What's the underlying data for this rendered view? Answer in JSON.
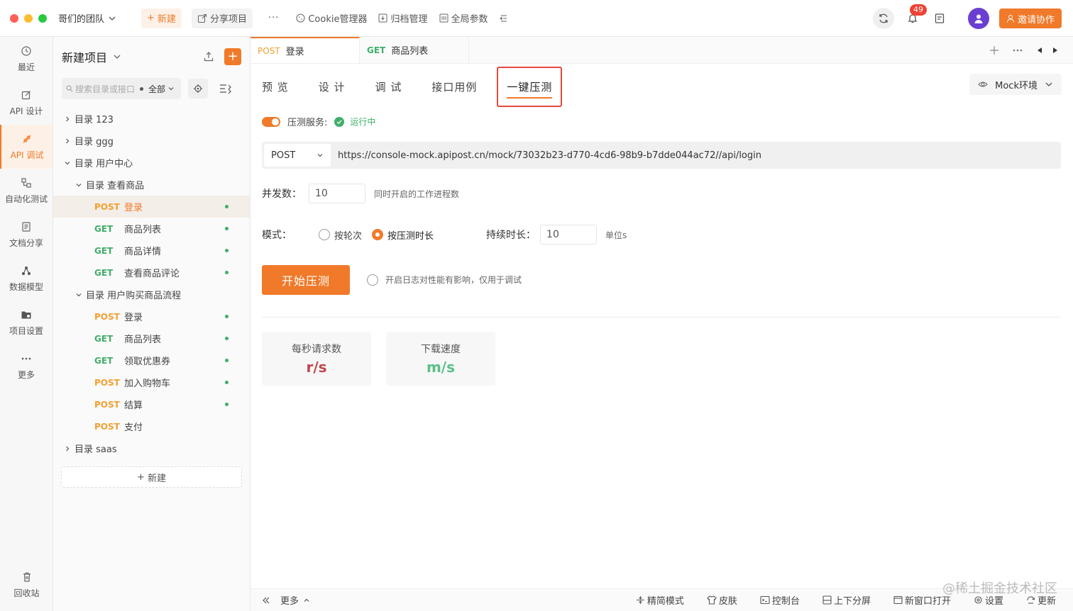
{
  "titlebar": {
    "team": "哥们的团队",
    "new_label": "新建",
    "share_label": "分享项目",
    "more": "···",
    "cookie_label": "Cookie管理器",
    "archive_label": "归档管理",
    "global_label": "全局参数",
    "notifications": "49",
    "invite_label": "邀请协作"
  },
  "rail": {
    "items": [
      {
        "label": "最近",
        "icon": "clock-icon"
      },
      {
        "label": "API 设计",
        "icon": "edit-icon"
      },
      {
        "label": "API 调试",
        "icon": "debug-icon"
      },
      {
        "label": "自动化测试",
        "icon": "flow-icon"
      },
      {
        "label": "文档分享",
        "icon": "doc-icon"
      },
      {
        "label": "数据模型",
        "icon": "model-icon"
      },
      {
        "label": "项目设置",
        "icon": "folder-gear-icon"
      },
      {
        "label": "更多",
        "icon": "dots-icon"
      }
    ],
    "trash": "回收站"
  },
  "tree": {
    "project": "新建项目",
    "search_placeholder": "搜索目录或接口",
    "filter": "全部",
    "nodes": [
      {
        "type": "dir",
        "name": "目录  123",
        "level": 0,
        "open": false
      },
      {
        "type": "dir",
        "name": "目录  ggg",
        "level": 0,
        "open": false
      },
      {
        "type": "dir",
        "name": "目录  用户中心",
        "level": 0,
        "open": true
      },
      {
        "type": "dir",
        "name": "目录  查看商品",
        "level": 1,
        "open": true
      },
      {
        "type": "api",
        "method": "POST",
        "name": "登录",
        "level": 2,
        "dot": true,
        "active": true
      },
      {
        "type": "api",
        "method": "GET",
        "name": "商品列表",
        "level": 2,
        "dot": true
      },
      {
        "type": "api",
        "method": "GET",
        "name": "商品详情",
        "level": 2,
        "dot": true
      },
      {
        "type": "api",
        "method": "GET",
        "name": "查看商品评论",
        "level": 2,
        "dot": true
      },
      {
        "type": "dir",
        "name": "目录  用户购买商品流程",
        "level": 1,
        "open": true
      },
      {
        "type": "api",
        "method": "POST",
        "name": "登录",
        "level": 2,
        "dot": true
      },
      {
        "type": "api",
        "method": "GET",
        "name": "商品列表",
        "level": 2,
        "dot": true
      },
      {
        "type": "api",
        "method": "GET",
        "name": "领取优惠券",
        "level": 2,
        "dot": true
      },
      {
        "type": "api",
        "method": "POST",
        "name": "加入购物车",
        "level": 2,
        "dot": true
      },
      {
        "type": "api",
        "method": "POST",
        "name": "结算",
        "level": 2,
        "dot": true
      },
      {
        "type": "api",
        "method": "POST",
        "name": "支付",
        "level": 2,
        "dot": false
      },
      {
        "type": "dir",
        "name": "目录  saas",
        "level": 0,
        "open": false
      }
    ],
    "new_label": "新建"
  },
  "tabs": [
    {
      "method": "POST",
      "name": "登录",
      "active": true
    },
    {
      "method": "GET",
      "name": "商品列表",
      "active": false
    }
  ],
  "subtabs": {
    "preview": "预 览",
    "design": "设 计",
    "debug": "调 试",
    "cases": "接口用例",
    "stress": "一键压测"
  },
  "mock_env": "Mock环境",
  "stress": {
    "service_label": "压测服务:",
    "service_status": "运行中",
    "method": "POST",
    "url": "https://console-mock.apipost.cn/mock/73032b23-d770-4cd6-98b9-b7dde044ac72//api/login",
    "concurrency_label": "并发数：",
    "concurrency_value": "10",
    "concurrency_hint": "同时开启的工作进程数",
    "mode_label": "模式：",
    "mode_rounds": "按轮次",
    "mode_duration": "按压测时长",
    "duration_label": "持续时长：",
    "duration_value": "10",
    "duration_unit": "单位s",
    "start_label": "开始压测",
    "log_hint": "开启日志对性能有影响，仅用于调试",
    "rps_title": "每秒请求数",
    "rps_unit": "r/s",
    "speed_title": "下载速度",
    "speed_unit": "m/s"
  },
  "statusbar": {
    "more": "更多",
    "simple": "精简模式",
    "skin": "皮肤",
    "console": "控制台",
    "split": "上下分屏",
    "new_window": "新窗口打开",
    "settings": "设置",
    "update": "更新"
  },
  "watermark": "@稀土掘金技术社区",
  "colors": {
    "accent": "#f07a2a",
    "post": "#f0a030",
    "get": "#3fae6a"
  }
}
